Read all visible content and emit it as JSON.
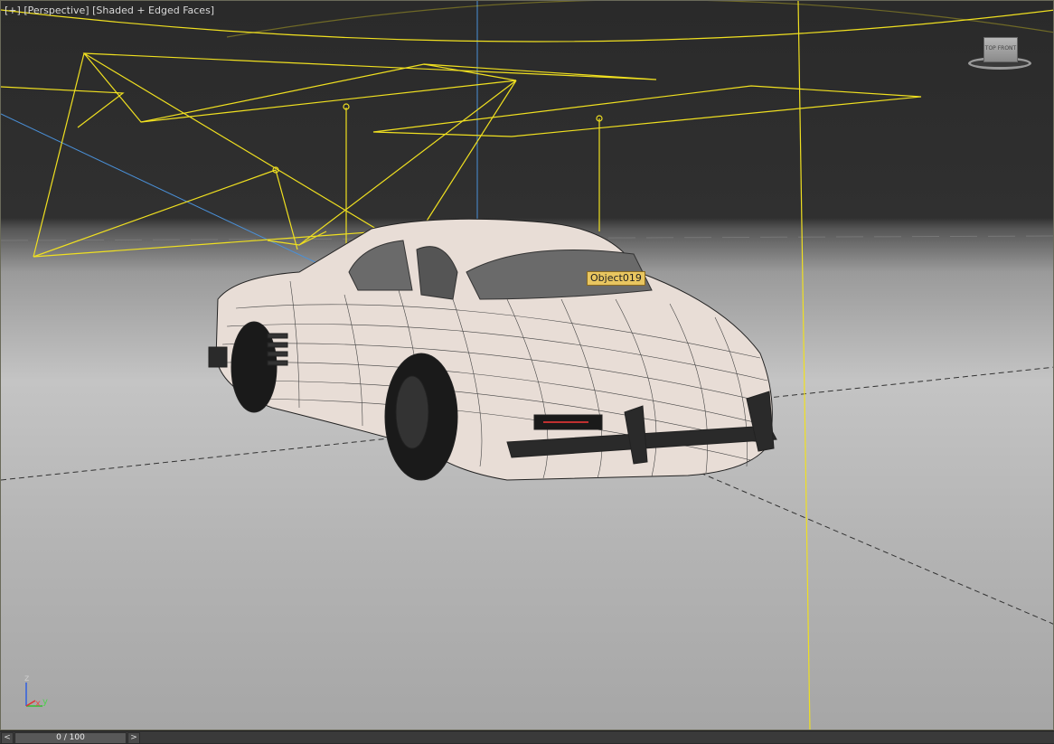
{
  "viewport": {
    "label_plus": "[+]",
    "label_view": "[Perspective]",
    "label_shading": "[Shaded + Edged Faces]",
    "object_tooltip": "Object019"
  },
  "viewcube": {
    "icon": "viewcube-icon",
    "face_text": "TOP FRONT"
  },
  "axis": {
    "z": "z",
    "x": "x",
    "y": "y"
  },
  "timebar": {
    "prev": "<",
    "next": ">",
    "frame": "0 / 100"
  },
  "colors": {
    "light_gizmo": "#f0e020",
    "grid_line": "#4a90d8",
    "car_body": "#e8ddd6"
  }
}
